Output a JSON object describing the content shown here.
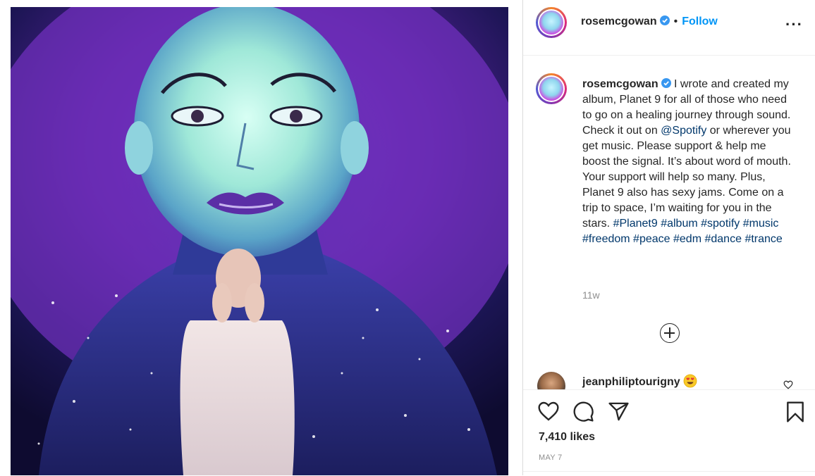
{
  "post": {
    "username": "rosemcgowan",
    "follow_label": "Follow",
    "separator": "•",
    "more_label": "···"
  },
  "caption": {
    "username": "rosemcgowan",
    "text_part1": " I wrote and created my album, Planet 9 for all of those who need to go on a healing journey through sound. Check it out on ",
    "mention": "@Spotify",
    "text_part2": " or wherever you get music. Please support & help me boost the signal. It’s about word of mouth. Your support will help so many. Plus, Planet 9 also has sexy jams. Come on a trip to space, I’m waiting for you in the stars. ",
    "hashtags": [
      "#Planet9",
      "#album",
      "#spotify",
      "#music",
      "#freedom",
      "#peace",
      "#edm",
      "#dance",
      "#trance"
    ],
    "age": "11w"
  },
  "comment": {
    "username": "jeanphiliptourigny",
    "emoji": "heart-eyes-emoji"
  },
  "footer": {
    "likes": "7,410 likes",
    "date": "MAY 7"
  },
  "icons": {
    "like": "heart-icon",
    "comment": "comment-bubble-icon",
    "share": "paper-plane-icon",
    "save": "bookmark-icon",
    "load_more": "plus-circle-icon"
  },
  "colors": {
    "link_blue": "#0095f6",
    "hashtag": "#00376b",
    "muted": "#8e8e8e",
    "verified": "#3897f0"
  }
}
